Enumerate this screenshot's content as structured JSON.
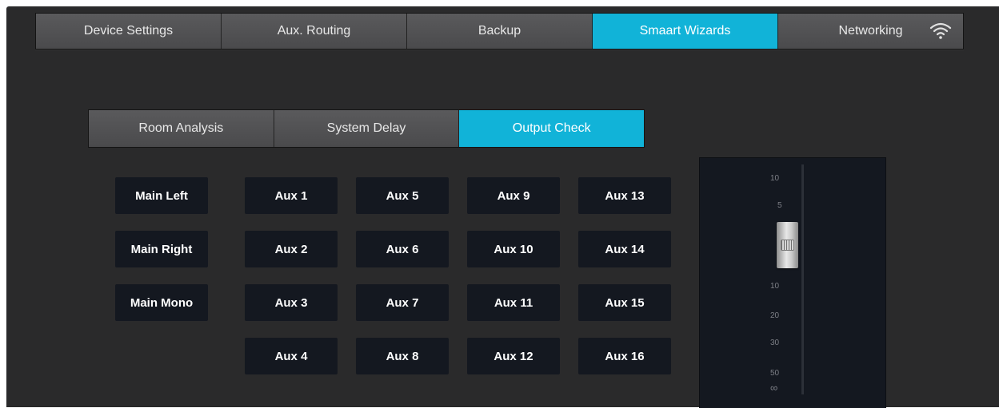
{
  "main_tabs": [
    {
      "label": "Device Settings",
      "active": false
    },
    {
      "label": "Aux. Routing",
      "active": false
    },
    {
      "label": "Backup",
      "active": false
    },
    {
      "label": "Smaart Wizards",
      "active": true
    },
    {
      "label": "Networking",
      "active": false
    }
  ],
  "wizard_tabs": [
    {
      "label": "Room Analysis",
      "active": false
    },
    {
      "label": "System Delay",
      "active": false
    },
    {
      "label": "Output Check",
      "active": true
    }
  ],
  "outputs": {
    "main": [
      "Main Left",
      "Main Right",
      "Main Mono"
    ],
    "aux_columns": [
      [
        "Aux 1",
        "Aux 2",
        "Aux 3",
        "Aux 4"
      ],
      [
        "Aux 5",
        "Aux 6",
        "Aux 7",
        "Aux 8"
      ],
      [
        "Aux 9",
        "Aux 10",
        "Aux 11",
        "Aux 12"
      ],
      [
        "Aux 13",
        "Aux 14",
        "Aux 15",
        "Aux 16"
      ]
    ]
  },
  "fader": {
    "scale_labels": [
      "10",
      "5",
      "10",
      "20",
      "30",
      "50",
      "∞"
    ]
  },
  "icons": {
    "networking_status": "wifi-icon"
  },
  "colors": {
    "accent": "#11b3d8",
    "background": "#2a2a2b",
    "button_dark": "#141820"
  }
}
